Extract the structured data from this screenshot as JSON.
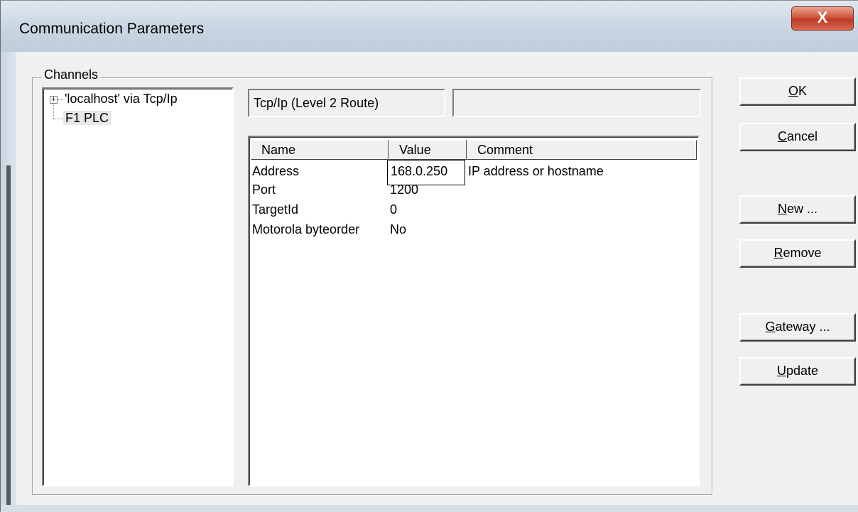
{
  "window": {
    "title": "Communication Parameters",
    "close_label": "X"
  },
  "channels": {
    "group_label": "Channels",
    "tree": [
      {
        "label": "'localhost' via Tcp/Ip",
        "expandable": true
      },
      {
        "label": "F1 PLC",
        "selected": true
      }
    ]
  },
  "driver": {
    "name": "Tcp/Ip (Level 2 Route)",
    "extra": ""
  },
  "params": {
    "columns": [
      "Name",
      "Value",
      "Comment"
    ],
    "rows": [
      {
        "name": "Address",
        "value": "168.0.250",
        "comment": "IP address or hostname"
      },
      {
        "name": "Port",
        "value": "1200",
        "comment": ""
      },
      {
        "name": "TargetId",
        "value": "0",
        "comment": ""
      },
      {
        "name": "Motorola byteorder",
        "value": "No",
        "comment": ""
      }
    ]
  },
  "buttons": {
    "ok": {
      "mnemonic": "O",
      "rest": "K"
    },
    "cancel": {
      "mnemonic": "C",
      "rest": "ancel"
    },
    "new": {
      "mnemonic": "N",
      "rest": "ew ..."
    },
    "remove": {
      "mnemonic": "R",
      "rest": "emove"
    },
    "gateway": {
      "mnemonic": "G",
      "rest": "ateway ..."
    },
    "update": {
      "mnemonic": "U",
      "rest": "pdate"
    }
  }
}
